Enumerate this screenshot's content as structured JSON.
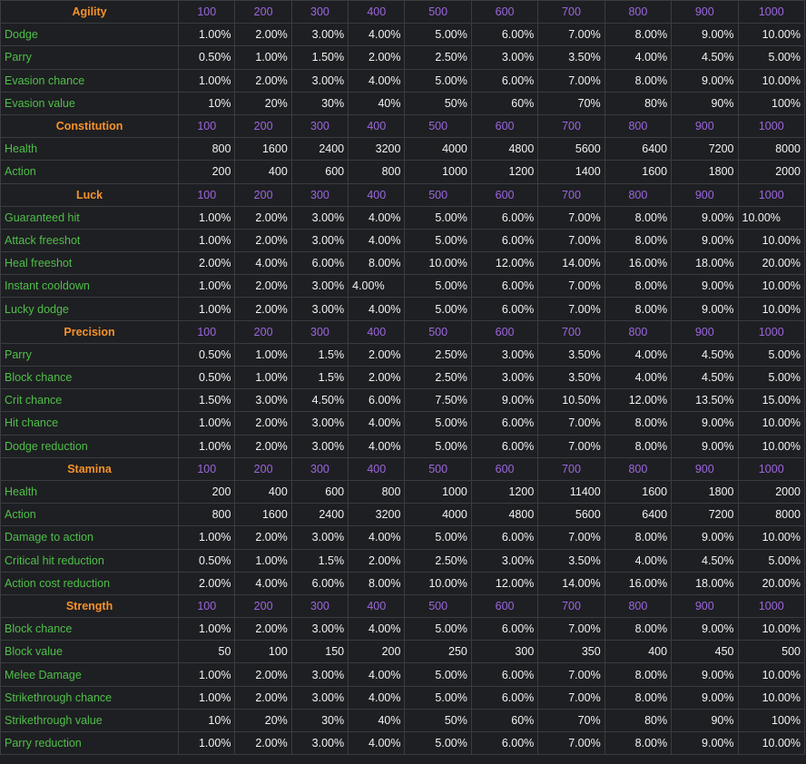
{
  "sections": [
    {
      "title": "Agility",
      "levels": [
        "100",
        "200",
        "300",
        "400",
        "500",
        "600",
        "700",
        "800",
        "900",
        "1000"
      ],
      "rows": [
        {
          "name": "Dodge",
          "values": [
            "1.00%",
            "2.00%",
            "3.00%",
            "4.00%",
            "5.00%",
            "6.00%",
            "7.00%",
            "8.00%",
            "9.00%",
            "10.00%"
          ]
        },
        {
          "name": "Parry",
          "values": [
            "0.50%",
            "1.00%",
            "1.50%",
            "2.00%",
            "2.50%",
            "3.00%",
            "3.50%",
            "4.00%",
            "4.50%",
            "5.00%"
          ]
        },
        {
          "name": "Evasion chance",
          "values": [
            "1.00%",
            "2.00%",
            "3.00%",
            "4.00%",
            "5.00%",
            "6.00%",
            "7.00%",
            "8.00%",
            "9.00%",
            "10.00%"
          ]
        },
        {
          "name": "Evasion value",
          "values": [
            "10%",
            "20%",
            "30%",
            "40%",
            "50%",
            "60%",
            "70%",
            "80%",
            "90%",
            "100%"
          ]
        }
      ]
    },
    {
      "title": "Constitution",
      "levels": [
        "100",
        "200",
        "300",
        "400",
        "500",
        "600",
        "700",
        "800",
        "900",
        "1000"
      ],
      "rows": [
        {
          "name": "Health",
          "values": [
            "800",
            "1600",
            "2400",
            "3200",
            "4000",
            "4800",
            "5600",
            "6400",
            "7200",
            "8000"
          ]
        },
        {
          "name": "Action",
          "values": [
            "200",
            "400",
            "600",
            "800",
            "1000",
            "1200",
            "1400",
            "1600",
            "1800",
            "2000"
          ]
        }
      ]
    },
    {
      "title": "Luck",
      "levels": [
        "100",
        "200",
        "300",
        "400",
        "500",
        "600",
        "700",
        "800",
        "900",
        "1000"
      ],
      "rows": [
        {
          "name": "Guaranteed hit",
          "values": [
            "1.00%",
            "2.00%",
            "3.00%",
            "4.00%",
            "5.00%",
            "6.00%",
            "7.00%",
            "8.00%",
            "9.00%",
            "10.00%"
          ],
          "left_aligned": [
            9
          ]
        },
        {
          "name": "Attack freeshot",
          "values": [
            "1.00%",
            "2.00%",
            "3.00%",
            "4.00%",
            "5.00%",
            "6.00%",
            "7.00%",
            "8.00%",
            "9.00%",
            "10.00%"
          ]
        },
        {
          "name": "Heal freeshot",
          "values": [
            "2.00%",
            "4.00%",
            "6.00%",
            "8.00%",
            "10.00%",
            "12.00%",
            "14.00%",
            "16.00%",
            "18.00%",
            "20.00%"
          ]
        },
        {
          "name": "Instant cooldown",
          "values": [
            "1.00%",
            "2.00%",
            "3.00%",
            "4.00%",
            "5.00%",
            "6.00%",
            "7.00%",
            "8.00%",
            "9.00%",
            "10.00%"
          ],
          "left_aligned": [
            3
          ]
        },
        {
          "name": "Lucky dodge",
          "values": [
            "1.00%",
            "2.00%",
            "3.00%",
            "4.00%",
            "5.00%",
            "6.00%",
            "7.00%",
            "8.00%",
            "9.00%",
            "10.00%"
          ]
        }
      ]
    },
    {
      "title": "Precision",
      "levels": [
        "100",
        "200",
        "300",
        "400",
        "500",
        "600",
        "700",
        "800",
        "900",
        "1000"
      ],
      "rows": [
        {
          "name": "Parry",
          "values": [
            "0.50%",
            "1.00%",
            "1.5%",
            "2.00%",
            "2.50%",
            "3.00%",
            "3.50%",
            "4.00%",
            "4.50%",
            "5.00%"
          ]
        },
        {
          "name": "Block chance",
          "values": [
            "0.50%",
            "1.00%",
            "1.5%",
            "2.00%",
            "2.50%",
            "3.00%",
            "3.50%",
            "4.00%",
            "4.50%",
            "5.00%"
          ]
        },
        {
          "name": "Crit chance",
          "values": [
            "1.50%",
            "3.00%",
            "4.50%",
            "6.00%",
            "7.50%",
            "9.00%",
            "10.50%",
            "12.00%",
            "13.50%",
            "15.00%"
          ]
        },
        {
          "name": "Hit chance",
          "values": [
            "1.00%",
            "2.00%",
            "3.00%",
            "4.00%",
            "5.00%",
            "6.00%",
            "7.00%",
            "8.00%",
            "9.00%",
            "10.00%"
          ]
        },
        {
          "name": "Dodge reduction",
          "values": [
            "1.00%",
            "2.00%",
            "3.00%",
            "4.00%",
            "5.00%",
            "6.00%",
            "7.00%",
            "8.00%",
            "9.00%",
            "10.00%"
          ]
        }
      ]
    },
    {
      "title": "Stamina",
      "levels": [
        "100",
        "200",
        "300",
        "400",
        "500",
        "600",
        "700",
        "800",
        "900",
        "1000"
      ],
      "rows": [
        {
          "name": "Health",
          "values": [
            "200",
            "400",
            "600",
            "800",
            "1000",
            "1200",
            "11400",
            "1600",
            "1800",
            "2000"
          ]
        },
        {
          "name": "Action",
          "values": [
            "800",
            "1600",
            "2400",
            "3200",
            "4000",
            "4800",
            "5600",
            "6400",
            "7200",
            "8000"
          ]
        },
        {
          "name": "Damage to action",
          "values": [
            "1.00%",
            "2.00%",
            "3.00%",
            "4.00%",
            "5.00%",
            "6.00%",
            "7.00%",
            "8.00%",
            "9.00%",
            "10.00%"
          ]
        },
        {
          "name": "Critical hit reduction",
          "values": [
            "0.50%",
            "1.00%",
            "1.5%",
            "2.00%",
            "2.50%",
            "3.00%",
            "3.50%",
            "4.00%",
            "4.50%",
            "5.00%"
          ]
        },
        {
          "name": "Action cost reduction",
          "values": [
            "2.00%",
            "4.00%",
            "6.00%",
            "8.00%",
            "10.00%",
            "12.00%",
            "14.00%",
            "16.00%",
            "18.00%",
            "20.00%"
          ]
        }
      ]
    },
    {
      "title": "Strength",
      "levels": [
        "100",
        "200",
        "300",
        "400",
        "500",
        "600",
        "700",
        "800",
        "900",
        "1000"
      ],
      "rows": [
        {
          "name": "Block chance",
          "values": [
            "1.00%",
            "2.00%",
            "3.00%",
            "4.00%",
            "5.00%",
            "6.00%",
            "7.00%",
            "8.00%",
            "9.00%",
            "10.00%"
          ]
        },
        {
          "name": "Block value",
          "values": [
            "50",
            "100",
            "150",
            "200",
            "250",
            "300",
            "350",
            "400",
            "450",
            "500"
          ]
        },
        {
          "name": "Melee Damage",
          "values": [
            "1.00%",
            "2.00%",
            "3.00%",
            "4.00%",
            "5.00%",
            "6.00%",
            "7.00%",
            "8.00%",
            "9.00%",
            "10.00%"
          ]
        },
        {
          "name": "Strikethrough chance",
          "values": [
            "1.00%",
            "2.00%",
            "3.00%",
            "4.00%",
            "5.00%",
            "6.00%",
            "7.00%",
            "8.00%",
            "9.00%",
            "10.00%"
          ]
        },
        {
          "name": "Strikethrough value",
          "values": [
            "10%",
            "20%",
            "30%",
            "40%",
            "50%",
            "60%",
            "70%",
            "80%",
            "90%",
            "100%"
          ]
        },
        {
          "name": "Parry reduction",
          "values": [
            "1.00%",
            "2.00%",
            "3.00%",
            "4.00%",
            "5.00%",
            "6.00%",
            "7.00%",
            "8.00%",
            "9.00%",
            "10.00%"
          ]
        }
      ]
    }
  ],
  "colors": {
    "background": "#1e1f22",
    "section_title": "#f6922b",
    "level_header": "#9c66e0",
    "stat_name": "#4fbf4a",
    "value": "#f2f2f2",
    "border": "#3b3c40"
  }
}
